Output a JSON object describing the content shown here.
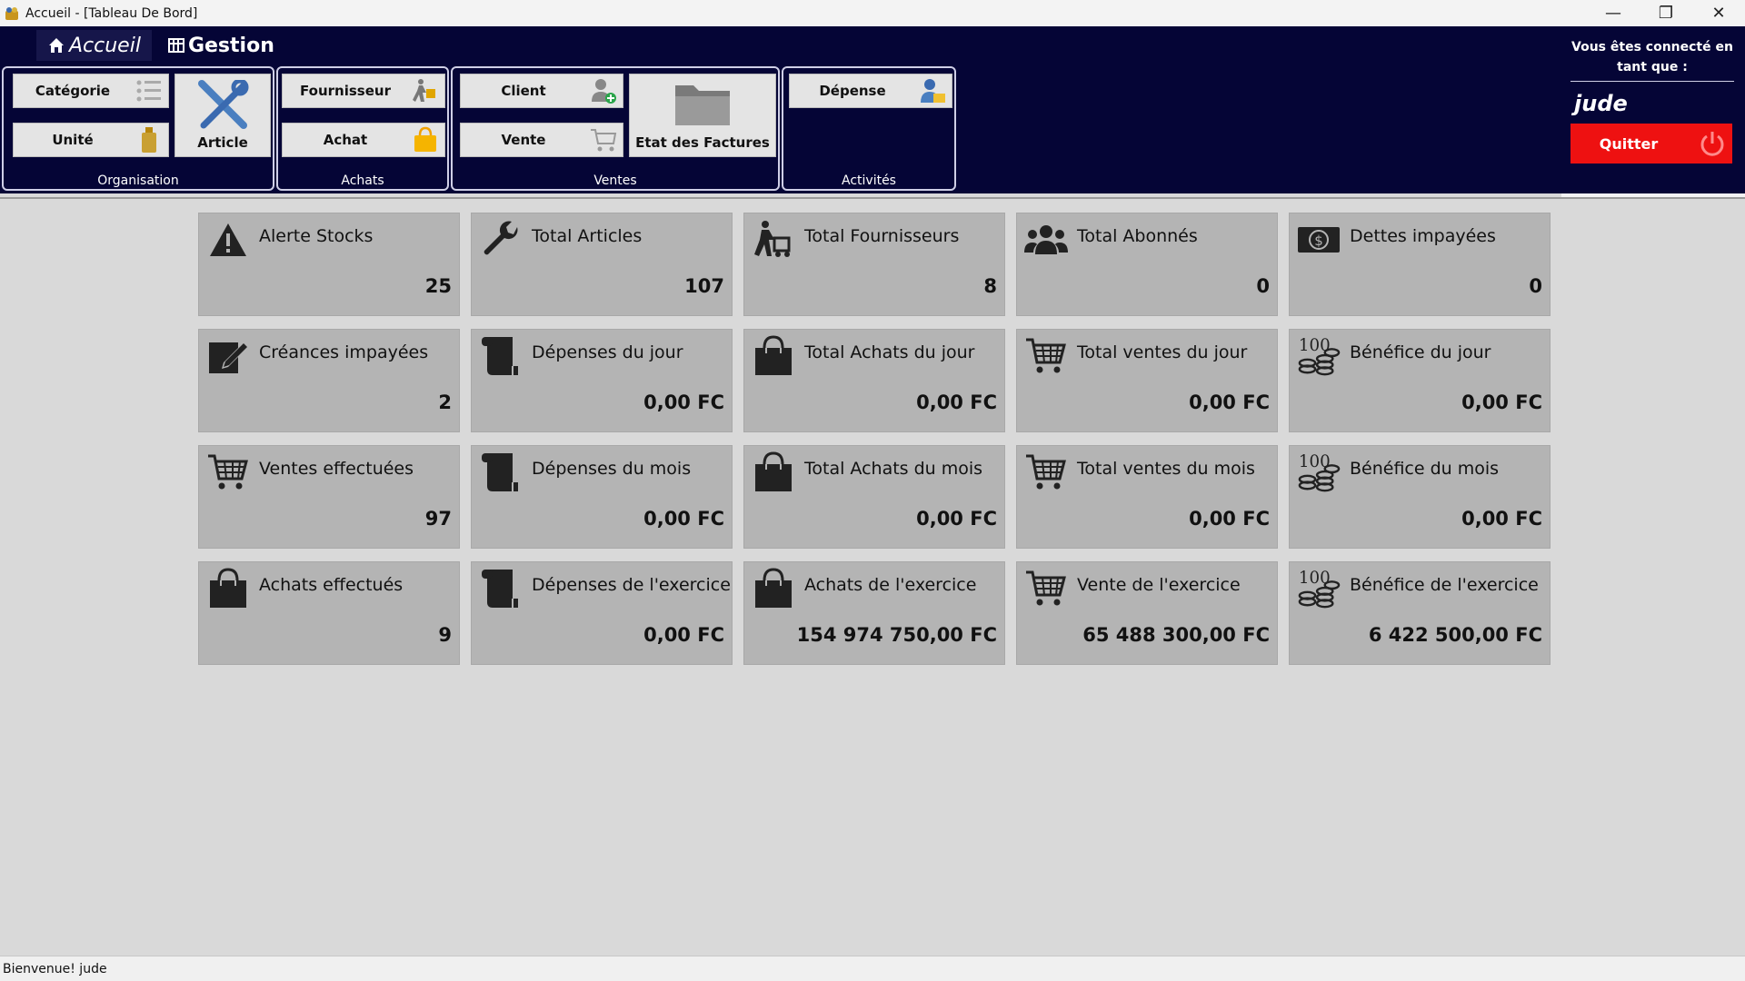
{
  "window": {
    "title": "Accueil - [Tableau De Bord]",
    "controls": {
      "minimize": "—",
      "restore": "❐",
      "close": "✕"
    }
  },
  "ribbon": {
    "tabs": [
      {
        "label": "Accueil",
        "icon": "home-icon"
      },
      {
        "label": "Gestion",
        "icon": "grid-icon"
      }
    ],
    "groups": {
      "organisation": {
        "label": "Organisation",
        "buttons": {
          "categorie": "Catégorie",
          "unite": "Unité",
          "article": "Article"
        }
      },
      "achats": {
        "label": "Achats",
        "buttons": {
          "fournisseur": "Fournisseur",
          "achat": "Achat"
        }
      },
      "ventes": {
        "label": "Ventes",
        "buttons": {
          "client": "Client",
          "vente": "Vente",
          "etat_factures": "Etat des Factures"
        }
      },
      "activites": {
        "label": "Activités",
        "buttons": {
          "depense": "Dépense"
        }
      }
    },
    "user": {
      "label": "Vous êtes connecté en tant que :",
      "name": "jude",
      "quit_label": "Quitter"
    }
  },
  "dashboard": {
    "cards": [
      {
        "title": "Alerte Stocks",
        "value": "25",
        "icon": "warning-icon"
      },
      {
        "title": "Total Articles",
        "value": "107",
        "icon": "wrench-icon"
      },
      {
        "title": "Total Fournisseurs",
        "value": "8",
        "icon": "delivery-icon"
      },
      {
        "title": "Total Abonnés",
        "value": "0",
        "icon": "users-icon"
      },
      {
        "title": "Dettes impayées",
        "value": "0",
        "icon": "money-icon"
      },
      {
        "title": "Créances impayées",
        "value": "2",
        "icon": "edit-icon"
      },
      {
        "title": "Dépenses du jour",
        "value": "0,00 FC",
        "icon": "scroll-icon"
      },
      {
        "title": "Total Achats du jour",
        "value": "0,00 FC",
        "icon": "bag-icon"
      },
      {
        "title": "Total ventes du jour",
        "value": "0,00 FC",
        "icon": "cart-icon"
      },
      {
        "title": "Bénéfice du jour",
        "value": "0,00 FC",
        "icon": "coins-icon"
      },
      {
        "title": "Ventes effectuées",
        "value": "97",
        "icon": "cart-icon"
      },
      {
        "title": "Dépenses du mois",
        "value": "0,00 FC",
        "icon": "scroll-icon"
      },
      {
        "title": "Total Achats du mois",
        "value": "0,00 FC",
        "icon": "bag-icon"
      },
      {
        "title": "Total ventes du mois",
        "value": "0,00 FC",
        "icon": "cart-icon"
      },
      {
        "title": "Bénéfice du mois",
        "value": "0,00 FC",
        "icon": "coins-icon"
      },
      {
        "title": "Achats effectués",
        "value": "9",
        "icon": "bag-icon"
      },
      {
        "title": "Dépenses de l'exercice",
        "value": "0,00 FC",
        "icon": "scroll-icon"
      },
      {
        "title": "Achats de l'exercice",
        "value": "154 974 750,00 FC",
        "icon": "bag-icon"
      },
      {
        "title": "Vente de l'exercice",
        "value": "65 488 300,00 FC",
        "icon": "cart-icon"
      },
      {
        "title": "Bénéfice de l'exercice",
        "value": "6 422 500,00 FC",
        "icon": "coins-icon"
      }
    ],
    "coins_label": "100"
  },
  "statusbar": {
    "text": "Bienvenue! jude"
  },
  "colors": {
    "ribbon_bg": "#050536",
    "quit_bg": "#ee1111",
    "card_bg": "#b4b4b4",
    "page_bg": "#d9d9d9"
  }
}
